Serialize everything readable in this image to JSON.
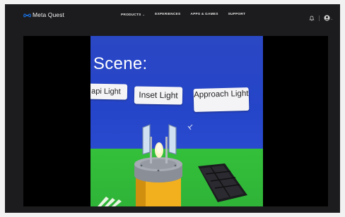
{
  "brand": {
    "name": "Meta Quest"
  },
  "nav": {
    "items": [
      {
        "label": "PRODUCTS",
        "has_dropdown": true
      },
      {
        "label": "EXPERIENCES",
        "has_dropdown": false
      },
      {
        "label": "APPS & GAMES",
        "has_dropdown": false
      },
      {
        "label": "SUPPORT",
        "has_dropdown": false
      }
    ],
    "right_icons": [
      "notifications-icon",
      "account-icon"
    ]
  },
  "video": {
    "scene": {
      "title": "t Scene:",
      "buttons": [
        {
          "label": "api Light"
        },
        {
          "label": "Inset Light"
        },
        {
          "label": "Approach Light"
        }
      ]
    }
  },
  "colors": {
    "page_background": "#1c1c1e",
    "video_letterbox": "#000000",
    "scene_sky": "#2545c9",
    "scene_ground": "#34c03a",
    "button_background": "#f4f4f7"
  }
}
